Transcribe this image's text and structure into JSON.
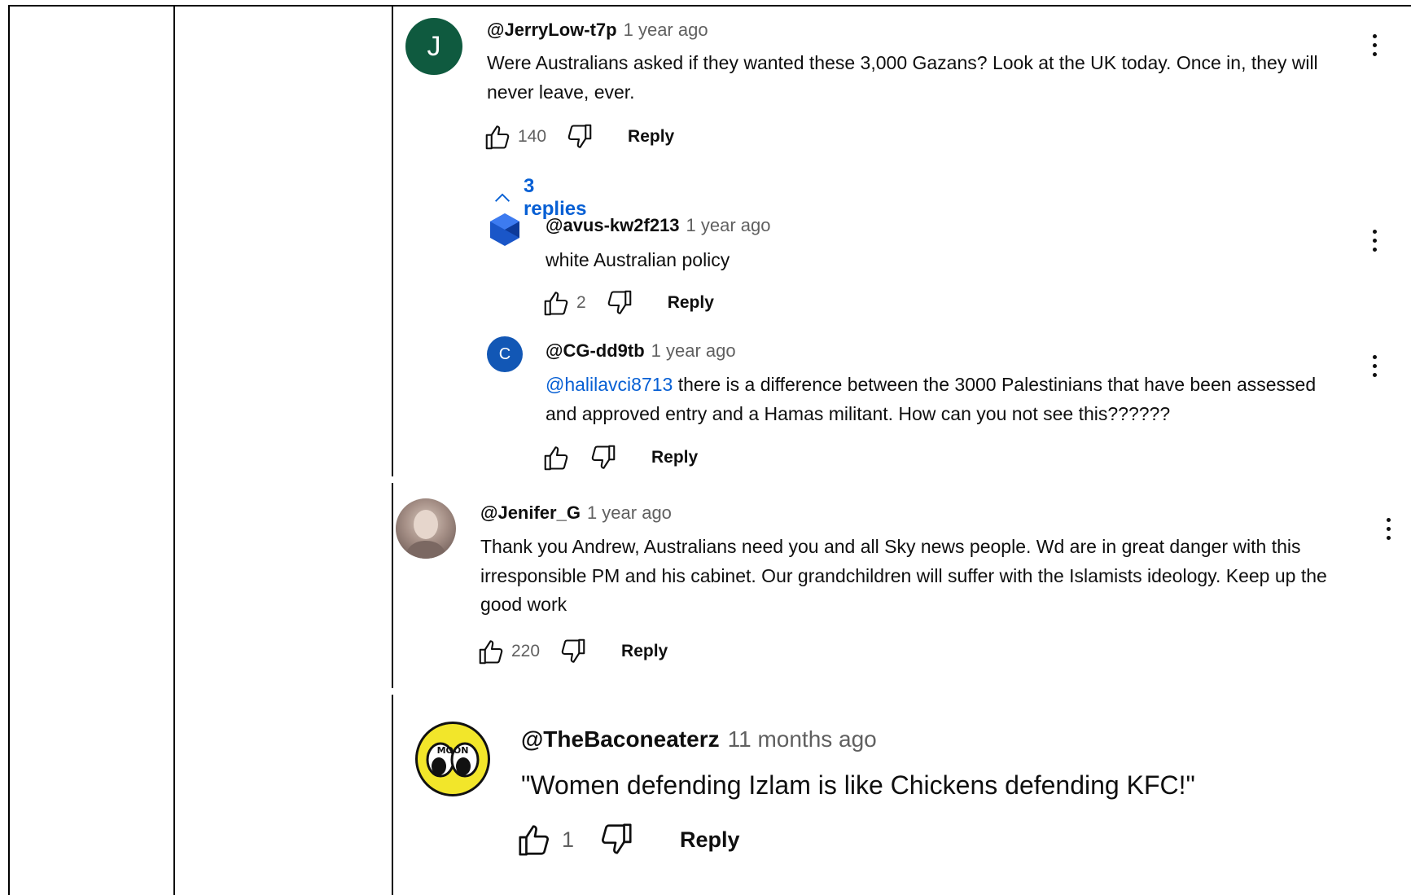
{
  "colors": {
    "accent": "#065fd4",
    "timestamp": "#606060",
    "avatar_j": "#0f5a3f",
    "avatar_c": "#1257b5"
  },
  "comments": [
    {
      "avatar_letter": "J",
      "author": "@JerryLow-t7p",
      "time": "1 year ago",
      "text": "Were Australians asked if they wanted these 3,000 Gazans? Look at the UK today. Once in, they will never leave, ever.",
      "likes": "140",
      "reply_label": "Reply",
      "replies_toggle": "3 replies",
      "replies": [
        {
          "author": "@avus-kw2f213",
          "time": "1 year ago",
          "text": "white Australian policy",
          "likes": "2",
          "reply_label": "Reply"
        },
        {
          "avatar_letter": "C",
          "author": "@CG-dd9tb",
          "time": "1 year ago",
          "mention": "@halilavci8713",
          "text": " there is a difference between the 3000 Palestinians that have been assessed and approved entry and a Hamas militant. How can you not see this??????",
          "likes": "",
          "reply_label": "Reply"
        }
      ]
    },
    {
      "author": "@Jenifer_G",
      "time": "1 year ago",
      "text": "Thank you Andrew, Australians need you and all Sky news people. Wd are in great danger with this irresponsible PM and his cabinet. Our grandchildren will suffer with the Islamists ideology. Keep up the good work",
      "likes": "220",
      "reply_label": "Reply"
    },
    {
      "avatar_text": "MOON",
      "author": "@TheBaconeaterz",
      "time": "11 months ago",
      "text": "\"Women defending Izlam is like Chickens defending KFC!\"",
      "likes": "1",
      "reply_label": "Reply"
    }
  ]
}
